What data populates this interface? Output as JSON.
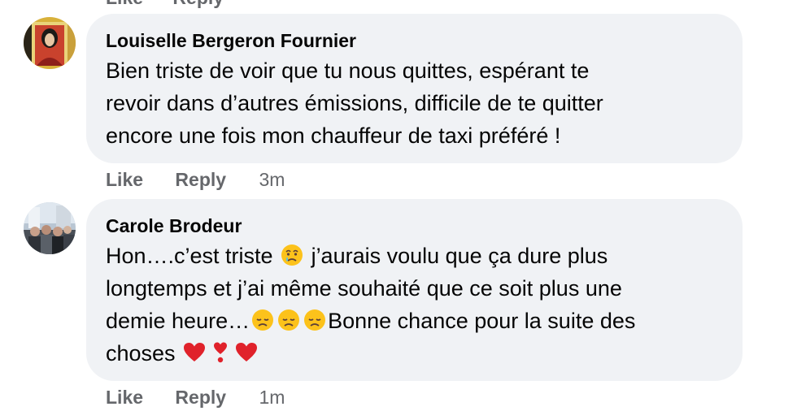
{
  "previous_comment": {
    "like_label": "Like",
    "reply_label": "Reply"
  },
  "comments": [
    {
      "author": "Louiselle Bergeron Fournier",
      "lines": [
        "Bien triste de voir que tu nous quittes, espérant te",
        "revoir dans d’autres émissions, difficile de te quitter",
        "encore une fois mon chauffeur de taxi préféré !"
      ],
      "like_label": "Like",
      "reply_label": "Reply",
      "time": "3m"
    },
    {
      "author": "Carole Brodeur",
      "segments": {
        "line1_a": "Hon….c’est triste ",
        "line1_b": " j’aurais voulu que ça dure plus",
        "line2": "longtemps et j’ai même souhaité que ce soit plus une",
        "line3_a": "demie heure…",
        "line3_b": "Bonne chance pour la suite des",
        "line4": "choses "
      },
      "emojis": {
        "line1": "crying-face",
        "line3": [
          "disappointed-face",
          "disappointed-face",
          "disappointed-face"
        ],
        "line4": [
          "red-heart",
          "heart-exclamation",
          "red-heart"
        ]
      },
      "like_label": "Like",
      "reply_label": "Reply",
      "time": "1m"
    }
  ],
  "colors": {
    "bubble_bg": "#f0f2f5",
    "author_text": "#050505",
    "meta_text": "#65676b"
  }
}
